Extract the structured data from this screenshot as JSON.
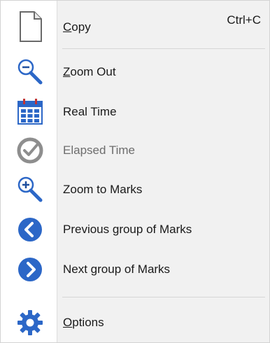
{
  "menu": {
    "items": [
      {
        "label_first": "C",
        "label_rest": "opy",
        "shortcut": "Ctrl+C",
        "icon": "copy-icon",
        "enabled": true
      },
      {
        "label_first": "Z",
        "label_rest": "oom Out",
        "icon": "zoom-out-icon",
        "enabled": true
      },
      {
        "label": "Real Time",
        "icon": "calendar-icon",
        "enabled": true
      },
      {
        "label": "Elapsed Time",
        "icon": "elapsed-time-icon",
        "enabled": false
      },
      {
        "label": "Zoom to Marks",
        "icon": "zoom-in-icon",
        "enabled": true
      },
      {
        "label": "Previous group of Marks",
        "icon": "chevron-left-icon",
        "enabled": true
      },
      {
        "label": "Next group of Marks",
        "icon": "chevron-right-icon",
        "enabled": true
      },
      {
        "label_first": "O",
        "label_rest": "ptions",
        "icon": "gear-icon",
        "enabled": true
      }
    ]
  },
  "colors": {
    "accent_blue": "#2c67c7",
    "disabled_gray": "#8e8e8e",
    "calendar_red": "#c13434"
  }
}
